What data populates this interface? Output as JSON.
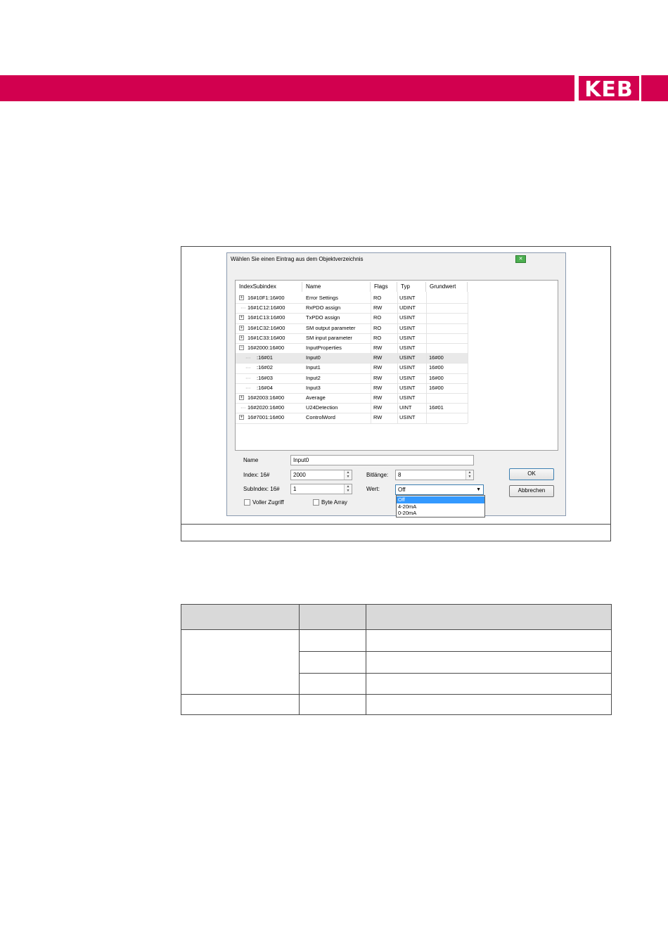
{
  "brand": {
    "logo_text": "KEB",
    "color": "#d2004f"
  },
  "dialog": {
    "title": "Wählen Sie einen Eintrag aus dem Objektverzeichnis",
    "columns": [
      "IndexSubindex",
      "Name",
      "Flags",
      "Typ",
      "Grundwert"
    ],
    "rows": [
      {
        "index": "16#10F1:16#00",
        "name": "Error Settings",
        "flags": "RO",
        "typ": "USINT",
        "grundwert": "",
        "expander": "+"
      },
      {
        "index": "16#1C12:16#00",
        "name": "RxPDO assign",
        "flags": "RW",
        "typ": "UDINT",
        "grundwert": "",
        "expander": ""
      },
      {
        "index": "16#1C13:16#00",
        "name": "TxPDO assign",
        "flags": "RO",
        "typ": "USINT",
        "grundwert": "",
        "expander": "+"
      },
      {
        "index": "16#1C32:16#00",
        "name": "SM output parameter",
        "flags": "RO",
        "typ": "USINT",
        "grundwert": "",
        "expander": "+"
      },
      {
        "index": "16#1C33:16#00",
        "name": "SM input parameter",
        "flags": "RO",
        "typ": "USINT",
        "grundwert": "",
        "expander": "+"
      },
      {
        "index": "16#2000:16#00",
        "name": "InputProperties",
        "flags": "RW",
        "typ": "USINT",
        "grundwert": "",
        "expander": "−"
      },
      {
        "index": ":16#01",
        "name": "Input0",
        "flags": "RW",
        "typ": "USINT",
        "grundwert": "16#00",
        "expander": ""
      },
      {
        "index": ":16#02",
        "name": "Input1",
        "flags": "RW",
        "typ": "USINT",
        "grundwert": "16#00",
        "expander": ""
      },
      {
        "index": ":16#03",
        "name": "Input2",
        "flags": "RW",
        "typ": "USINT",
        "grundwert": "16#00",
        "expander": ""
      },
      {
        "index": ":16#04",
        "name": "Input3",
        "flags": "RW",
        "typ": "USINT",
        "grundwert": "16#00",
        "expander": ""
      },
      {
        "index": "16#2003:16#00",
        "name": "Average",
        "flags": "RW",
        "typ": "USINT",
        "grundwert": "",
        "expander": "+"
      },
      {
        "index": "16#2020:16#00",
        "name": "U24Detection",
        "flags": "RW",
        "typ": "UINT",
        "grundwert": "16#01",
        "expander": ""
      },
      {
        "index": "16#7001:16#00",
        "name": "ControlWord",
        "flags": "RW",
        "typ": "USINT",
        "grundwert": "",
        "expander": "+"
      }
    ],
    "form": {
      "name_label": "Name",
      "name_value": "Input0",
      "index_label": "Index: 16#",
      "index_value": "2000",
      "subindex_label": "SubIndex: 16#",
      "subindex_value": "1",
      "bitlaenge_label": "Bitlänge:",
      "bitlaenge_value": "8",
      "wert_label": "Wert:",
      "wert_value": "Off",
      "wert_options": [
        "Off",
        "4-20mA",
        "0-20mA"
      ],
      "voller_zugriff_label": "Voller Zugriff",
      "byte_array_label": "Byte Array"
    },
    "buttons": {
      "ok": "OK",
      "cancel": "Abbrechen"
    }
  }
}
